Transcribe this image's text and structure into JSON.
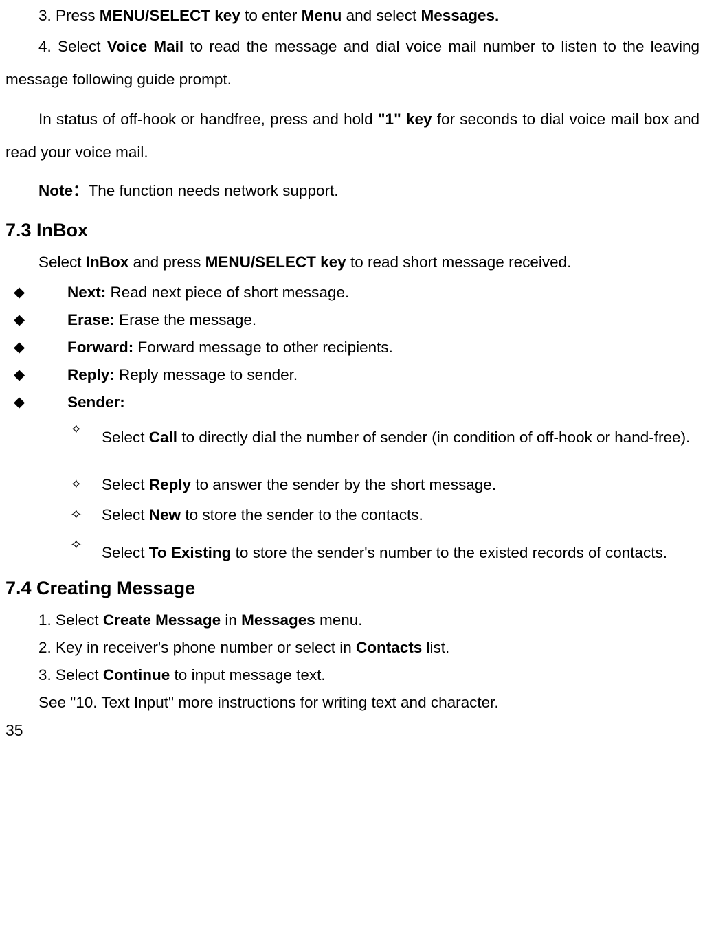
{
  "step3": {
    "prefix": "3. Press ",
    "b1": "MENU/SELECT key",
    "mid1": " to enter ",
    "b2": "Menu",
    "mid2": " and select ",
    "b3": "Messages."
  },
  "step4": {
    "prefix": "4. Select ",
    "b1": "Voice Mail",
    "mid": " to read the message and dial voice mail number to listen to the leaving message following guide prompt."
  },
  "holdKey": {
    "prefix": "In status of off-hook or handfree, press and hold ",
    "b1": "\"1\" key",
    "suffix": " for seconds to dial voice mail box and read your voice mail."
  },
  "note": {
    "label": "Note：",
    "text": "The function needs network support."
  },
  "h73": "7.3 InBox",
  "inboxSelect": {
    "t1": "Select ",
    "b1": "InBox",
    "t2": " and press ",
    "b2": "MENU/SELECT key",
    "t3": " to read short message received."
  },
  "bullets": {
    "next": {
      "label": "Next: ",
      "text": "Read next piece of short message."
    },
    "erase": {
      "label": "Erase: ",
      "text": "Erase the message."
    },
    "forward": {
      "label": "Forward: ",
      "text": "Forward message to other recipients."
    },
    "reply": {
      "label": "Reply: ",
      "text": "Reply message to sender."
    },
    "sender": {
      "label": "Sender:"
    }
  },
  "sender": {
    "call": {
      "t1": "Select ",
      "b": "Call",
      "t2": " to directly dial the number of sender (in condition of off-hook or hand-free)."
    },
    "reply": {
      "t1": "Select ",
      "b": "Reply",
      "t2": " to answer the sender by the short message."
    },
    "new": {
      "t1": "Select ",
      "b": "New",
      "t2": " to store the sender to the contacts."
    },
    "toex": {
      "t1": "Select ",
      "b": "To Existing",
      "t2": " to store the sender's number to the existed records of contacts."
    }
  },
  "h74": "7.4 Creating Message",
  "create": {
    "s1": {
      "t1": "1. Select ",
      "b1": "Create Message",
      "t2": " in ",
      "b2": "Messages",
      "t3": " menu."
    },
    "s2": {
      "t1": "2. Key in receiver's phone number or select in ",
      "b1": "Contacts",
      "t2": " list."
    },
    "s3": {
      "t1": "3. Select ",
      "b1": "Continue",
      "t2": " to input message text."
    }
  },
  "seeRef": "See \"10. Text Input\" more instructions for writing text and character.",
  "pageNum": "35"
}
